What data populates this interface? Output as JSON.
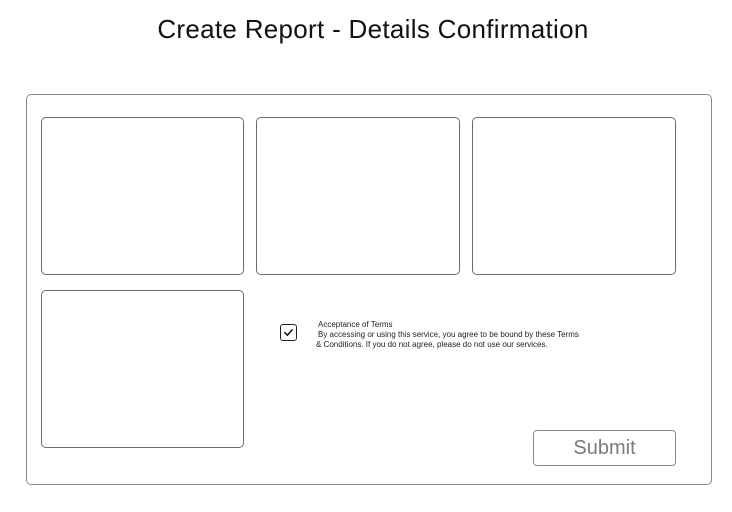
{
  "header": {
    "title": "Create Report - Details Confirmation"
  },
  "terms": {
    "checked": true,
    "title": "Acceptance of Terms",
    "body_line1": "By accessing or using this service, you agree to be bound by these Terms",
    "body_line2": "& Conditions. If you do not agree, please do not use our services."
  },
  "actions": {
    "submit_label": "Submit"
  },
  "icons": {
    "checkbox": "checkmark-icon"
  },
  "colors": {
    "border": "#8a8a8a",
    "text": "#111111",
    "submit_text": "#7a7a7a"
  }
}
